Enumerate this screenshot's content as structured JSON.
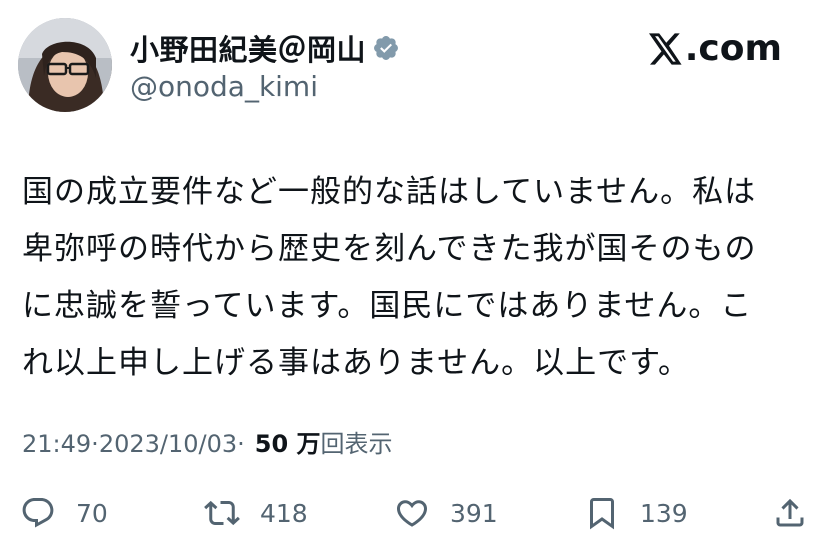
{
  "author": {
    "display_name": "小野田紀美＠岡山",
    "handle": "@onoda_kimi",
    "verified": true,
    "verified_color": "#829aab"
  },
  "brand": {
    "label": ".com"
  },
  "tweet": {
    "text": "国の成立要件など一般的な話はしていません。私は\n卑弥呼の時代から歴史を刻んできた我が国そのもの\nに忠誠を誓っています。国民にではありません。こ\nれ以上申し上げる事はありません。以上です。"
  },
  "meta": {
    "time": "21:49",
    "date": "2023/10/03",
    "separator": " · ",
    "views_count": "50 万",
    "views_label": "回表示"
  },
  "actions": {
    "reply_count": "70",
    "retweet_count": "418",
    "like_count": "391",
    "bookmark_count": "139"
  },
  "colors": {
    "text": "#0f1419",
    "secondary": "#536471"
  }
}
